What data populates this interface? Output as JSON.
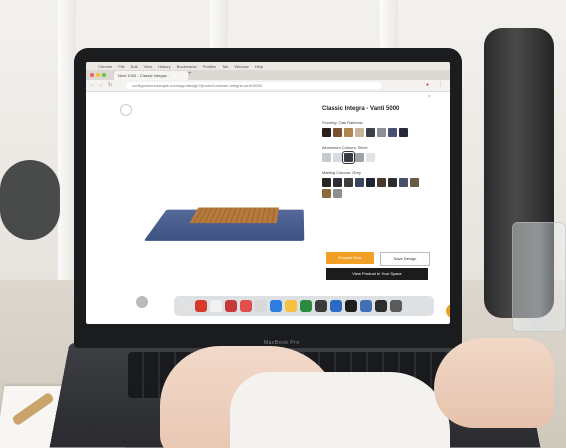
{
  "browser": {
    "tab_title": "Next 1000 - Classic Integra...",
    "url": "configurator.example.com/app/design?product=classic-integra-vanti-5000"
  },
  "menubar": [
    "Chrome",
    "File",
    "Edit",
    "View",
    "History",
    "Bookmarks",
    "Profiles",
    "Tab",
    "Window",
    "Help"
  ],
  "product": {
    "title": "Classic Integra - Vanti 5000",
    "flooring_label": "Flooring: Oak Rainbow",
    "aluminium_label": "Aluminium Colours: Silver",
    "matting_label": "Matting Colours: Grey"
  },
  "buttons": {
    "enquire": "Enquire Now",
    "save": "Save Design",
    "view_product": "View Product In Your Space"
  },
  "brand": "MacBook Pro",
  "colors": {
    "accent": "#f0a024",
    "dark_button": "#1c1c1c",
    "rug_blue": "#4a5e90"
  },
  "flooring_swatches": [
    "#2a1f1b",
    "#7a5130",
    "#b08450",
    "#c9b39a",
    "#3f3f4a",
    "#8a8f98",
    "#4a4e70",
    "#27293a"
  ],
  "aluminium_swatches": [
    "#c7cbd1",
    "#d9dbe0",
    "#3a3d46",
    "#9ea3aa",
    "#e3e3e3"
  ],
  "matting_swatches": [
    "#262626",
    "#2a2f3a",
    "#3d3d3d",
    "#3a4660",
    "#1e2430",
    "#4a3a2c",
    "#2d2d2d",
    "#48506a",
    "#6a5a44",
    "#8b6a3a",
    "#8f8f8f"
  ],
  "dock_icons": [
    "#e1e1e1",
    "#d83b2e",
    "#f2f2f2",
    "#c63a3a",
    "#e24d4d",
    "#d8d8d8",
    "#2d7de0",
    "#f6c142",
    "#2b8a3e",
    "#3b3b3b",
    "#2a69c4",
    "#1d1d1d",
    "#3f6fb4",
    "#2d2d2d",
    "#5a5a5a"
  ]
}
